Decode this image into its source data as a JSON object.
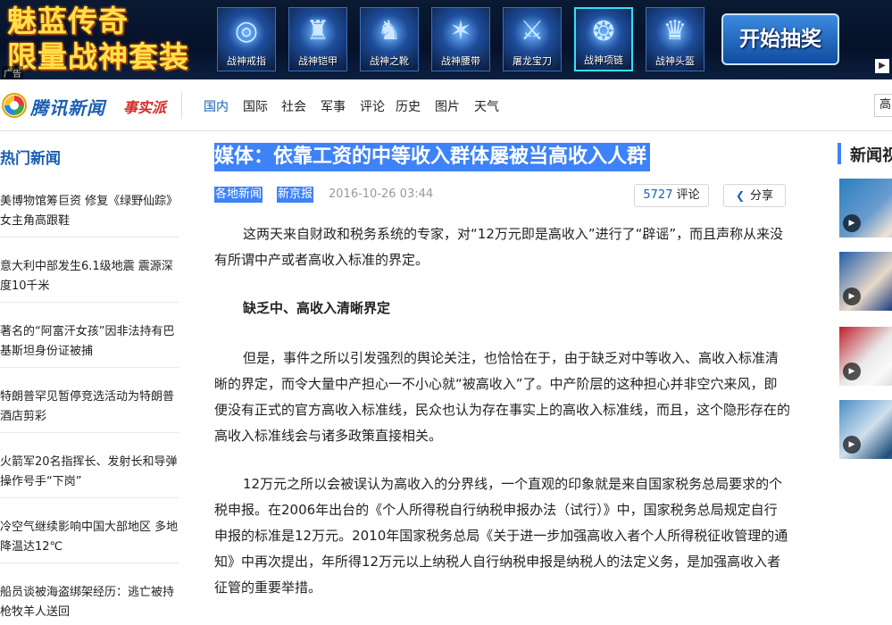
{
  "banner": {
    "line1": "魅蓝传奇",
    "line2": "限量战神套装",
    "ad_tag": "广告",
    "items": [
      {
        "label": "战神戒指",
        "icon": "ring-icon"
      },
      {
        "label": "战神铠甲",
        "icon": "armor-icon"
      },
      {
        "label": "战神之靴",
        "icon": "boots-icon"
      },
      {
        "label": "战神腰带",
        "icon": "belt-icon"
      },
      {
        "label": "屠龙宝刀",
        "icon": "sword-icon"
      },
      {
        "label": "战神项链",
        "icon": "necklace-icon"
      },
      {
        "label": "战神头盔",
        "icon": "helmet-icon"
      }
    ],
    "cta": "开始抽奖"
  },
  "header": {
    "logo_text": "腾讯新闻",
    "logo_sub": "事实派",
    "nav": [
      "国内",
      "国际",
      "社会",
      "军事",
      "评论",
      "历史",
      "图片",
      "天气"
    ],
    "active_nav": "国内",
    "search_value": "高"
  },
  "sidebar": {
    "title": "热门新闻",
    "items": [
      "美博物馆筹巨资 修复《绿野仙踪》女主角高跟鞋",
      "意大利中部发生6.1级地震 震源深度10千米",
      "著名的“阿富汗女孩”因非法持有巴基斯坦身份证被捕",
      "特朗普罕见暂停竞选活动为特朗普酒店剪彩",
      "火箭军20名指挥长、发射长和导弹操作号手“下岗”",
      "冷空气继续影响中国大部地区 多地降温达12℃",
      "船员谈被海盗绑架经历：逃亡被持枪牧羊人送回"
    ]
  },
  "article": {
    "headline": "媒体：依靠工资的中等收入群体屡被当高收入人群",
    "tags": [
      "各地新闻",
      "新京报"
    ],
    "date": "2016-10-26 03:44",
    "comments_count": "5727",
    "comments_label": "评论",
    "share_label": "分享",
    "paragraphs": [
      "这两天来自财政和税务系统的专家，对“12万元即是高收入”进行了“辟谣”，而且声称从来没有所谓中产或者高收入标准的界定。",
      "缺乏中、高收入清晰界定",
      "但是，事件之所以引发强烈的舆论关注，也恰恰在于，由于缺乏对中等收入、高收入标准清晰的界定，而令大量中产担心一不小心就“被高收入”了。中产阶层的这种担心并非空穴来风，即便没有正式的官方高收入标准线，民众也认为存在事实上的高收入标准线，而且，这个隐形存在的高收入标准线会与诸多政策直接相关。",
      "12万元之所以会被误认为高收入的分界线，一个直观的印象就是来自国家税务总局要求的个税申报。在2006年出台的《个人所得税自行纳税申报办法（试行）》中，国家税务总局规定自行申报的标准是12万元。2010年国家税务总局《关于进一步加强高收入者个人所得税征收管理的通知》中再次提出，年所得12万元以上纳税人自行纳税申报是纳税人的法定义务，是加强高收入者征管的重要举措。"
    ]
  },
  "right": {
    "title": "新闻视频"
  },
  "colors": {
    "brand_blue": "#1a5fb4",
    "highlight": "#3e82f7",
    "banner_gold": "#ffe14a"
  }
}
